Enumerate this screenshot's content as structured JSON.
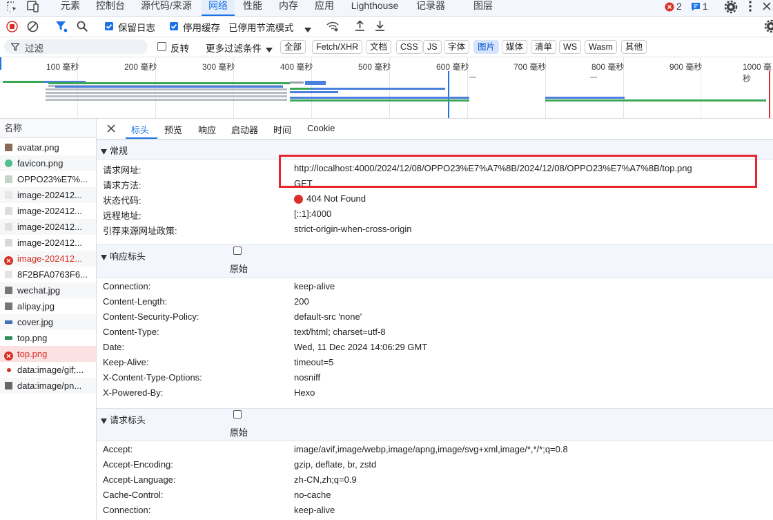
{
  "top_tabs": [
    {
      "label": "元素"
    },
    {
      "label": "控制台"
    },
    {
      "label": "源代码/来源"
    },
    {
      "label": "网络"
    },
    {
      "label": "性能"
    },
    {
      "label": "内存"
    },
    {
      "label": "应用"
    },
    {
      "label": "Lighthouse"
    },
    {
      "label": "记录器"
    },
    {
      "label": "图层"
    }
  ],
  "top_status": {
    "errors": "2",
    "messages": "1"
  },
  "toolbar": {
    "preserve_log": "保留日志",
    "disable_cache": "停用缓存",
    "throttle": "已停用节流模式"
  },
  "filter": {
    "placeholder": "过滤",
    "invert": "反转",
    "more_filters": "更多过滤条件",
    "types": [
      "全部",
      "Fetch/XHR",
      "文档",
      "CSS",
      "JS",
      "字体",
      "图片",
      "媒体",
      "清单",
      "WS",
      "Wasm",
      "其他"
    ],
    "active_type": "图片"
  },
  "timeline": {
    "ticks": [
      "100 毫秒",
      "200 毫秒",
      "300 毫秒",
      "400 毫秒",
      "500 毫秒",
      "600 毫秒",
      "700 毫秒",
      "800 毫秒",
      "900 毫秒",
      "1000 毫秒"
    ]
  },
  "request_list": {
    "header": "名称",
    "items": [
      {
        "name": "avatar.png",
        "status": "ok"
      },
      {
        "name": "favicon.png",
        "status": "ok"
      },
      {
        "name": "OPPO23%E7%...",
        "status": "ok"
      },
      {
        "name": "image-202412...",
        "status": "ok"
      },
      {
        "name": "image-202412...",
        "status": "ok"
      },
      {
        "name": "image-202412...",
        "status": "ok"
      },
      {
        "name": "image-202412...",
        "status": "ok"
      },
      {
        "name": "image-202412...",
        "status": "error"
      },
      {
        "name": "8F2BFA0763F6...",
        "status": "ok"
      },
      {
        "name": "wechat.jpg",
        "status": "ok"
      },
      {
        "name": "alipay.jpg",
        "status": "ok"
      },
      {
        "name": "cover.jpg",
        "status": "ok"
      },
      {
        "name": "top.png",
        "status": "ok"
      },
      {
        "name": "top.png",
        "status": "error"
      },
      {
        "name": "data:image/gif;...",
        "status": "ok"
      },
      {
        "name": "data:image/pn...",
        "status": "ok"
      }
    ]
  },
  "detail_tabs": [
    "标头",
    "预览",
    "响应",
    "启动器",
    "时间",
    "Cookie"
  ],
  "general": {
    "title": "常规",
    "rows": [
      {
        "key": "请求网址:",
        "value": "http://localhost:4000/2024/12/08/OPPO23%E7%A7%8B/2024/12/08/OPPO23%E7%A7%8B/top.png"
      },
      {
        "key": "请求方法:",
        "value": "GET"
      },
      {
        "key": "状态代码:",
        "value": "404 Not Found"
      },
      {
        "key": "远程地址:",
        "value": "[::1]:4000"
      },
      {
        "key": "引荐来源网址政策:",
        "value": "strict-origin-when-cross-origin"
      }
    ]
  },
  "response_headers": {
    "title": "响应标头",
    "raw_label": "原始",
    "rows": [
      {
        "key": "Connection:",
        "value": "keep-alive"
      },
      {
        "key": "Content-Length:",
        "value": "200"
      },
      {
        "key": "Content-Security-Policy:",
        "value": "default-src 'none'"
      },
      {
        "key": "Content-Type:",
        "value": "text/html; charset=utf-8"
      },
      {
        "key": "Date:",
        "value": "Wed, 11 Dec 2024 14:06:29 GMT"
      },
      {
        "key": "Keep-Alive:",
        "value": "timeout=5"
      },
      {
        "key": "X-Content-Type-Options:",
        "value": "nosniff"
      },
      {
        "key": "X-Powered-By:",
        "value": "Hexo"
      }
    ]
  },
  "request_headers": {
    "title": "请求标头",
    "raw_label": "原始",
    "rows": [
      {
        "key": "Accept:",
        "value": "image/avif,image/webp,image/apng,image/svg+xml,image/*,*/*;q=0.8"
      },
      {
        "key": "Accept-Encoding:",
        "value": "gzip, deflate, br, zstd"
      },
      {
        "key": "Accept-Language:",
        "value": "zh-CN,zh;q=0.9"
      },
      {
        "key": "Cache-Control:",
        "value": "no-cache"
      },
      {
        "key": "Connection:",
        "value": "keep-alive"
      }
    ]
  },
  "colors": {
    "accent": "#1a73e8",
    "error": "#d93025",
    "highlight_box": "#e8242c"
  }
}
